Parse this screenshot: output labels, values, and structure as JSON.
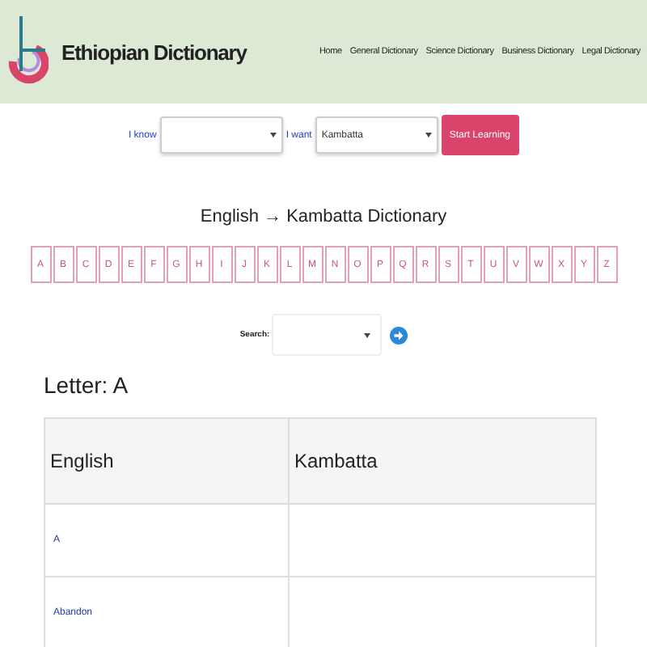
{
  "header": {
    "title": "Ethiopian Dictionary",
    "nav": [
      "Home",
      "General Dictionary",
      "Science Dictionary",
      "Business Dictionary",
      "Legal Dictionary"
    ]
  },
  "form": {
    "know_label": "I know",
    "want_label": "I want",
    "want_value": "Kambatta",
    "button": "Start Learning"
  },
  "heading": "English → Kambatta Dictionary",
  "letters": [
    "A",
    "B",
    "C",
    "D",
    "E",
    "F",
    "G",
    "H",
    "I",
    "J",
    "K",
    "L",
    "M",
    "N",
    "O",
    "P",
    "Q",
    "R",
    "S",
    "T",
    "U",
    "V",
    "W",
    "X",
    "Y",
    "Z"
  ],
  "search": {
    "label": "Search:"
  },
  "letter_heading": "Letter: A",
  "table": {
    "columns": [
      "English",
      "Kambatta"
    ],
    "rows": [
      {
        "english": "A"
      },
      {
        "english": "Abandon"
      }
    ]
  }
}
